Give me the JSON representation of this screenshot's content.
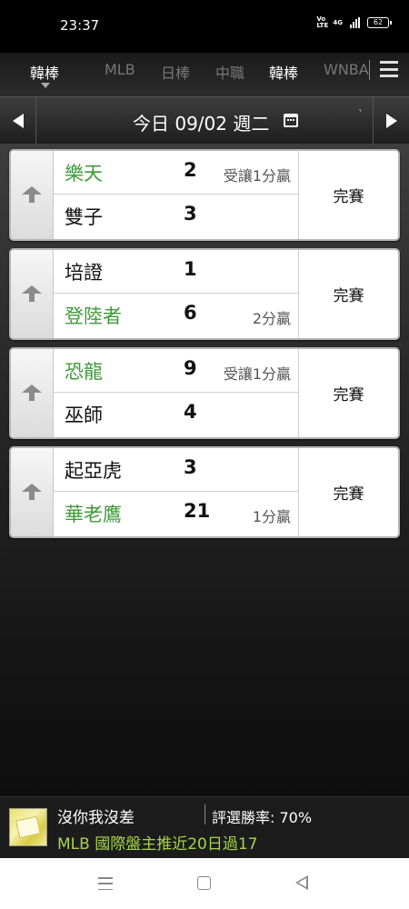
{
  "status_bar": {
    "time": "23:37",
    "volte": "Vo LTE",
    "network": "4G",
    "battery": "62"
  },
  "league_tabs": [
    {
      "label": "韓棒",
      "active": true
    },
    {
      "label": "MLB",
      "active": false
    },
    {
      "label": "日棒",
      "active": false
    },
    {
      "label": "中職",
      "active": false
    },
    {
      "label": "韓棒",
      "active": false
    },
    {
      "label": "WNBA",
      "active": false
    }
  ],
  "date_bar": {
    "label": "今日 09/02 週二",
    "tick": "`"
  },
  "games": [
    {
      "home": {
        "team": "樂天",
        "score": "2",
        "note": "受讓1分贏",
        "favored": true
      },
      "away": {
        "team": "雙子",
        "score": "3",
        "note": "",
        "favored": false
      },
      "status": "完賽"
    },
    {
      "home": {
        "team": "培證",
        "score": "1",
        "note": "",
        "favored": false
      },
      "away": {
        "team": "登陸者",
        "score": "6",
        "note": "2分贏",
        "favored": true
      },
      "status": "完賽"
    },
    {
      "home": {
        "team": "恐龍",
        "score": "9",
        "note": "受讓1分贏",
        "favored": true
      },
      "away": {
        "team": "巫師",
        "score": "4",
        "note": "",
        "favored": false
      },
      "status": "完賽"
    },
    {
      "home": {
        "team": "起亞虎",
        "score": "3",
        "note": "",
        "favored": false
      },
      "away": {
        "team": "華老鷹",
        "score": "21",
        "note": "1分贏",
        "favored": true
      },
      "status": "完賽"
    }
  ],
  "promo": {
    "name": "沒你我沒差",
    "rate": "評選勝率: 70%",
    "subtitle": "MLB 國際盤主推近20日過17"
  },
  "colors": {
    "favored_team": "#3f9a3a",
    "promo_subtitle": "#a5d44a",
    "card_bg": "#ffffff"
  }
}
